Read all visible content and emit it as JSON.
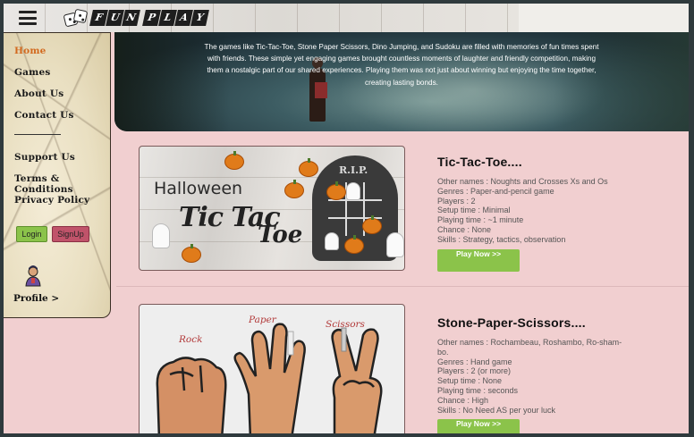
{
  "brand": {
    "logo_letters": [
      "F",
      "U",
      "N",
      "P",
      "L",
      "A",
      "Y"
    ]
  },
  "nav": {
    "items": [
      {
        "label": "Home",
        "active": true
      },
      {
        "label": "Games"
      },
      {
        "label": "About Us"
      },
      {
        "label": "Contact Us"
      }
    ],
    "secondary": [
      {
        "label": "Support Us"
      },
      {
        "label": "Terms & Conditions"
      },
      {
        "label": "Privacy Policy"
      }
    ],
    "login_label": "Login",
    "signup_label": "SignUp",
    "profile_label": "Profile >"
  },
  "hero": {
    "text": "The games like Tic-Tac-Toe, Stone Paper Scissors, Dino Jumping, and Sudoku are filled with memories of fun times spent with friends. These simple yet engaging games brought countless moments of laughter and friendly competition, making them a nostalgic part of our shared experiences. Playing them was not just about winning but enjoying the time together, creating lasting bonds."
  },
  "games": [
    {
      "title": "Tic-Tac-Toe....",
      "image": {
        "line1": "Halloween",
        "line2": "Tic Tac",
        "line3": "Toe",
        "tombstone": "R.I.P."
      },
      "details": [
        "Other names : Noughts and Crosses Xs and Os",
        "Genres : Paper-and-pencil game",
        "Players : 2",
        "Setup time : Minimal",
        "Playing time : ~1 minute",
        "Chance : None",
        "Skills : Strategy, tactics, observation"
      ],
      "play_label": "Play Now >>"
    },
    {
      "title": "Stone-Paper-Scissors....",
      "image": {
        "rock": "Rock",
        "paper": "Paper",
        "scissors": "Scissors"
      },
      "details": [
        "Other names : Rochambeau, Roshambo, Ro-sham-",
        "bo.",
        "Genres : Hand game",
        "Players : 2 (or more)",
        "Setup time : None",
        "Playing time : seconds",
        "Chance : High",
        "Skills : No Need AS per your luck"
      ],
      "play_label": "Play Now >>"
    }
  ],
  "colors": {
    "page_bg": "#f1cfd0",
    "accent_green": "#8bc34a",
    "active_nav": "#d2691e",
    "signup": "#c0536a"
  },
  "icons": [
    "hamburger-menu-icon",
    "dice-logo-icon",
    "avatar-icon"
  ]
}
